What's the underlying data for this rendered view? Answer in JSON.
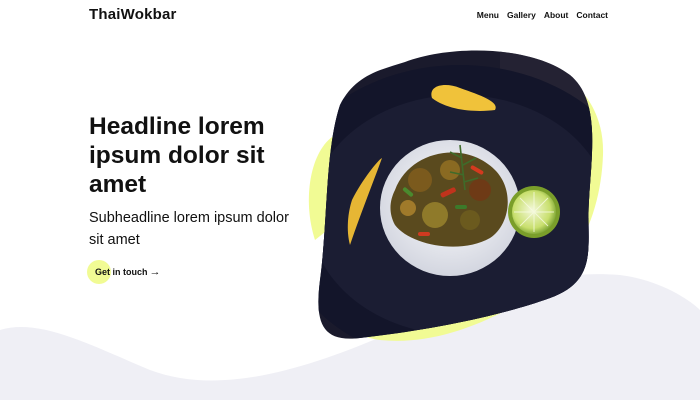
{
  "header": {
    "brand": "ThaiWokbar",
    "nav": [
      "Menu",
      "Gallery",
      "About",
      "Contact"
    ]
  },
  "hero": {
    "title": "Headline lorem ipsum dolor sit amet",
    "subtitle": "Subheadline lorem ipsum dolor sit amet",
    "cta_label": "Get in touch",
    "cta_arrow": "→"
  },
  "colors": {
    "accent_yellow": "#f1fb94",
    "background_wave": "#efeff5",
    "text": "#111111",
    "plate": "#16182a"
  },
  "icons": {
    "cta_arrow": "arrow-right-icon"
  }
}
